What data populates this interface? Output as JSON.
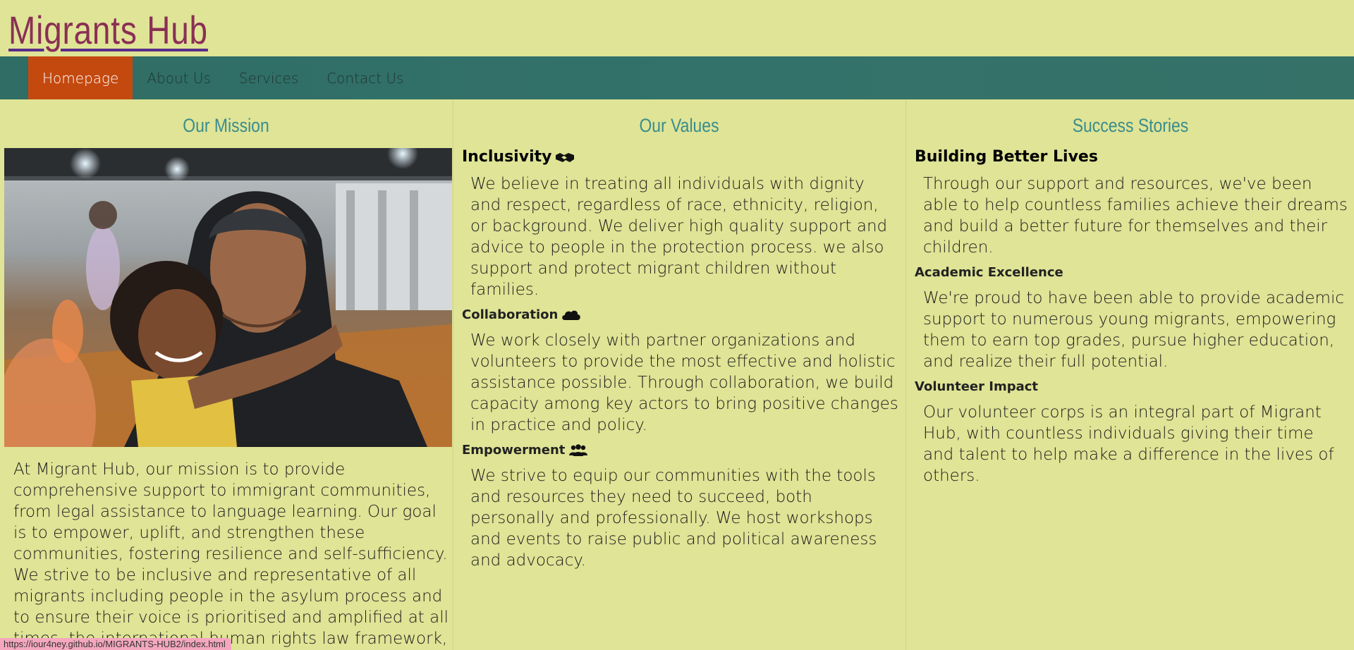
{
  "site": {
    "title": "Migrants Hub"
  },
  "nav": {
    "items": [
      "Homepage",
      "About Us",
      "Services",
      "Contact Us"
    ],
    "active": "Homepage"
  },
  "colors": {
    "background": "#dfe496",
    "nav_bg": "#336f68",
    "nav_active": "#c4490f",
    "heading": "#3a8c8e",
    "title": "#8a2f55"
  },
  "mission": {
    "heading": "Our Mission",
    "text": "At Migrant Hub, our mission is to provide comprehensive support to immigrant communities, from legal assistance to language learning. Our goal is to empower, uplift, and strengthen these communities, fostering resilience and self-sufficiency. We strive to be inclusive and representative of all migrants including people in the asylum process and to ensure their voice is prioritised and amplified at all times. the international human rights law framework, and the fundamental rights of migrants is at"
  },
  "values": {
    "heading": "Our Values",
    "items": [
      {
        "title": "Inclusivity",
        "icon": "handshake-icon",
        "text": "We believe in treating all individuals with dignity and respect, regardless of race, ethnicity, religion, or background. We deliver high quality support and advice to people in the protection process. we also support and protect migrant children without families."
      },
      {
        "title": "Collaboration",
        "icon": "cloud-icon",
        "text": "We work closely with partner organizations and volunteers to provide the most effective and holistic assistance possible. Through collaboration, we build capacity among key actors to bring positive changes in practice and policy."
      },
      {
        "title": "Empowerment",
        "icon": "users-icon",
        "text": "We strive to equip our communities with the tools and resources they need to succeed, both personally and professionally. We host workshops and events to raise public and political awareness and advocacy."
      }
    ]
  },
  "stories": {
    "heading": "Success Stories",
    "items": [
      {
        "title": "Building Better Lives",
        "text": "Through our support and resources, we've been able to help countless families achieve their dreams and build a better future for themselves and their children."
      },
      {
        "title": "Academic Excellence",
        "text": "We're proud to have been able to provide academic support to numerous young migrants, empowering them to earn top grades, pursue higher education, and realize their full potential."
      },
      {
        "title": "Volunteer Impact",
        "text": "Our volunteer corps is an integral part of Migrant Hub, with countless individuals giving their time and talent to help make a difference in the lives of others."
      }
    ]
  },
  "status_bar": {
    "url": "https://iour4ney.github.io/MIGRANTS-HUB2/index.html"
  }
}
